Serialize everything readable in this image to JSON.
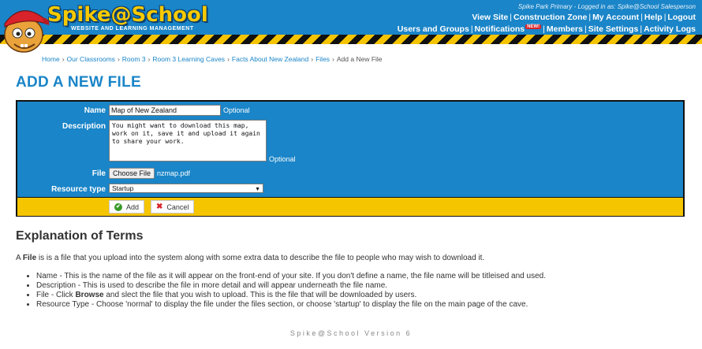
{
  "header": {
    "logo_text": "Spike@School",
    "logo_sub": "WEBSITE AND LEARNING MANAGEMENT",
    "logged_in": "Spike Park Primary - Logged in as: Spike@School Salesperson",
    "nav_row1": [
      "View Site",
      "Construction Zone",
      "My Account",
      "Help",
      "Logout"
    ],
    "nav_row2": [
      "Users and Groups",
      "Notifications",
      "Members",
      "Site Settings",
      "Activity Logs"
    ],
    "new_badge": "NEW!"
  },
  "breadcrumb": [
    "Home",
    "Our Classrooms",
    "Room 3",
    "Room 3 Learning Caves",
    "Facts About New Zealand",
    "Files",
    "Add a New File"
  ],
  "page_title": "ADD A NEW FILE",
  "form": {
    "name_label": "Name",
    "name_value": "Map of New Zealand",
    "optional": "Optional",
    "description_label": "Description",
    "description_value": "You might want to download this map,\nwork on it, save it and upload it again\nto share your work.",
    "file_label": "File",
    "file_button": "Choose File",
    "file_name": "nzmap.pdf",
    "resource_type_label": "Resource type",
    "resource_type_value": "Startup",
    "add_button": "Add",
    "cancel_button": "Cancel"
  },
  "explanation": {
    "title": "Explanation of Terms",
    "intro_pre": "A ",
    "intro_bold": "File",
    "intro_post": " is is a file that you upload into the system along with some extra data to describe the file to people who may wish to download it.",
    "item_name": "Name - This is the name of the file as it will appear on the front-end of your site. If you don't define a name, the file name will be titleised and used.",
    "item_description": "Description - This is used to describe the file in more detail and will appear underneath the file name.",
    "item_file_pre": "File - Click ",
    "item_file_bold": "Browse",
    "item_file_post": " and slect the file that you wish to upload. This is the file that will be downloaded by users.",
    "item_resource": "Resource Type - Choose 'normal' to display the file under the files section, or choose 'startup' to display the file on the main page of the cave."
  },
  "footer": "Spike@School Version 6",
  "colors": {
    "brand_blue": "#1a85c8",
    "brand_yellow": "#f5c500"
  }
}
